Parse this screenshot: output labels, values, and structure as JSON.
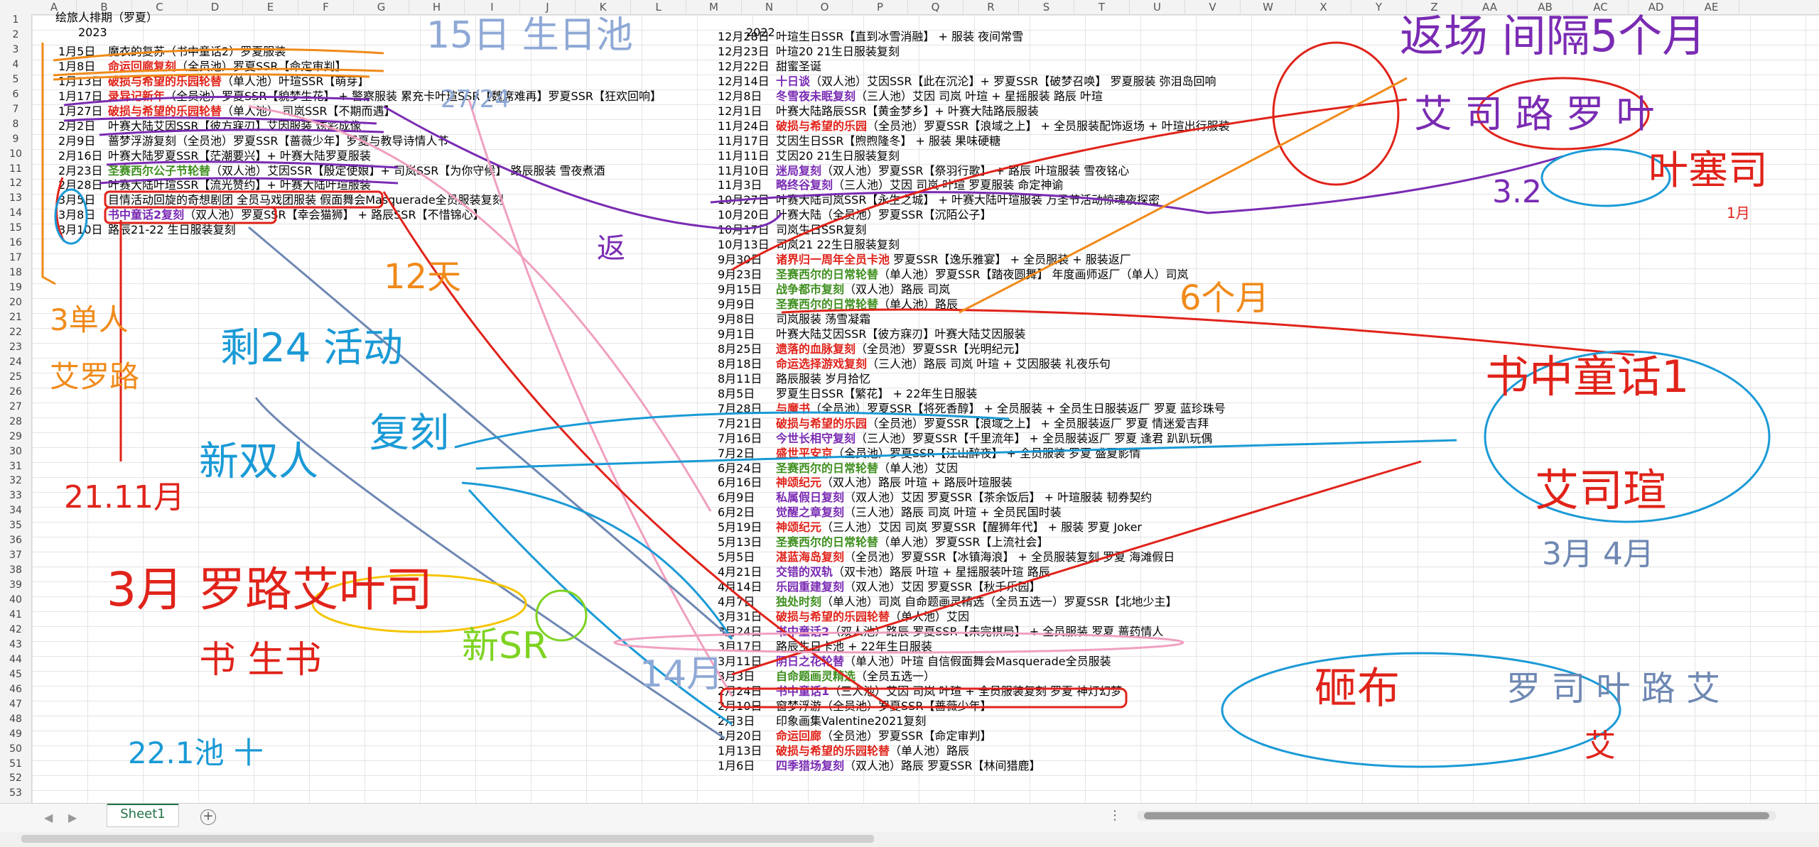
{
  "columns": [
    "A",
    "B",
    "C",
    "D",
    "E",
    "F",
    "G",
    "H",
    "I",
    "J",
    "K",
    "L",
    "M",
    "N",
    "O",
    "P",
    "Q",
    "R",
    "S",
    "T",
    "U",
    "V",
    "W",
    "X",
    "Y",
    "Z",
    "AA",
    "AB",
    "AC",
    "AD",
    "AE"
  ],
  "rows": [
    "1",
    "2",
    "3",
    "4",
    "5",
    "6",
    "7",
    "8",
    "9",
    "10",
    "11",
    "12",
    "13",
    "14",
    "15",
    "16",
    "17",
    "18",
    "19",
    "20",
    "21",
    "22",
    "23",
    "24",
    "25",
    "26",
    "27",
    "28",
    "29",
    "30",
    "31",
    "32",
    "33",
    "34",
    "35",
    "36",
    "37",
    "38",
    "39",
    "40",
    "41",
    "42",
    "43",
    "44",
    "45",
    "46",
    "47",
    "48",
    "49",
    "50",
    "51",
    "52",
    "53"
  ],
  "sheet": {
    "title": "绘旅人排期（罗夏）",
    "year_left": "2023",
    "year_right": "2022",
    "tab_name": "Sheet1"
  },
  "left_entries": [
    {
      "date": "1月5日",
      "text": "魔衣的复苏（书中童话2）罗夏服装"
    },
    {
      "date": "1月8日",
      "text": "命运回廊复刻（全员池）罗夏SSR【命定审判】"
    },
    {
      "date": "1月13日",
      "text": "破损与希望的乐园轮替（单人池）叶瑄SSR【萌芽】"
    },
    {
      "date": "1月17日",
      "text": "录异记新年（全员池）罗夏SSR【貌梦生花】 + 警察服装    累充卡叶瑄SSR【魏席难再】罗夏SSR【狂欢回响】"
    },
    {
      "date": "1月27日",
      "text": "破损与希望的乐园轮替（单人池） 司岚SSR【不期而遇】"
    },
    {
      "date": "2月2日",
      "text": "叶赛大陆艾因SSR【彼方寐刃】艾因服装 炫彩成像"
    },
    {
      "date": "2月9日",
      "text": "蔷梦浮游复刻（全员池）罗夏SSR【蔷薇少年】罗夏与教导诗情人节"
    },
    {
      "date": "2月16日",
      "text": "叶赛大陆罗夏SSR【茫潮要兴】+ 叶赛大陆罗夏服装"
    },
    {
      "date": "2月23日",
      "text": "圣赛西尔公子节轮替（双人池）艾因SSR【殷定使娘】+ 司岚SSR【为你守候】 路辰服装 雪夜煮酒"
    },
    {
      "date": "2月28日",
      "text": "叶赛大陆叶瑄SSR【流光赞约】+ 叶赛大陆叶瑄服装"
    },
    {
      "date": "3月5日",
      "text": "目情活动回旋的奇想剧团 全员马戏团服装    假面舞会Masquerade全员服装复刻"
    },
    {
      "date": "3月8日",
      "text": "书中童话2复刻（双人池）罗夏SSR【幸会猫狮】 + 路辰SSR【不惜锦心】"
    },
    {
      "date": "3月10日",
      "text": "路辰21-22 生日服装复刻"
    }
  ],
  "right_entries": [
    {
      "date": "12月28日",
      "text": "叶瑄生日SSR【直到冰雪消融】 + 服装 夜间常雪"
    },
    {
      "date": "12月23日",
      "text": "叶瑄20 21生日服装复刻"
    },
    {
      "date": "12月22日",
      "text": "甜蜜圣诞"
    },
    {
      "date": "12月14日",
      "text": "十日谈（双人池）艾因SSR【此在沉沦】+ 罗夏SSR【破梦召唤】 罗夏服装 弥泪岛回响"
    },
    {
      "date": "12月8日",
      "text": "冬雪夜未眠复刻（三人池）艾因 司岚 叶瑄 + 星摇服装 路辰 叶瑄"
    },
    {
      "date": "12月1日",
      "text": "叶赛大陆路辰SSR【黄金梦乡】+ 叶赛大陆路辰服装"
    },
    {
      "date": "11月24日",
      "text": "破损与希望的乐园（全员池）罗夏SSR【浪域之上】 + 全员服装配饰返场 + 叶瑄出行服装"
    },
    {
      "date": "11月17日",
      "text": "艾因生日SSR【煦煦隆冬】 + 服装 果味硬糖"
    },
    {
      "date": "11月11日",
      "text": "艾因20 21生日服装复刻"
    },
    {
      "date": "11月10日",
      "text": "迷局复刻（双人池）罗夏SSR【祭羽行歌】 + 路辰 叶瑄服装 雪夜铭心"
    },
    {
      "date": "11月3日",
      "text": "略终谷复刻（三人池）艾因 司岚 叶瑄 罗夏服装 命定神谕"
    },
    {
      "date": "10月27日",
      "text": "叶赛大陆司岚SSR【永生之城】 + 叶赛大陆叶瑄服装 万圣节活动惊魂夜探密"
    },
    {
      "date": "10月20日",
      "text": "叶赛大陆（全员池）罗夏SSR【沉陌公子】"
    },
    {
      "date": "10月17日",
      "text": "司岚生日SSR复刻"
    },
    {
      "date": "10月13日",
      "text": "司岚21 22生日服装复刻"
    },
    {
      "date": "9月30日",
      "text": "诸界归一周年全员卡池 罗夏SSR【逸乐雅宴】 + 全员服装 + 服装返厂"
    },
    {
      "date": "9月23日",
      "text": "圣赛西尔的日常轮替（单人池）罗夏SSR【踏夜圆舞】 年度画师返厂（单人）司岚"
    },
    {
      "date": "9月15日",
      "text": "战争都市复刻（双人池）路辰 司岚"
    },
    {
      "date": "9月9日",
      "text": "圣赛西尔的日常轮替（单人池）路辰"
    },
    {
      "date": "9月8日",
      "text": "司岚服装 荡雪凝霜"
    },
    {
      "date": "9月1日",
      "text": "叶赛大陆艾因SSR【彼方寐刃】叶赛大陆艾因服装"
    },
    {
      "date": "8月25日",
      "text": "遗落的血脉复刻（全员池）罗夏SSR【光明纪元】"
    },
    {
      "date": "8月18日",
      "text": "命运选择游戏复刻（三人池）路辰 司岚 叶瑄 + 艾因服装 礼夜乐句"
    },
    {
      "date": "8月11日",
      "text": "路辰服装 岁月拾忆"
    },
    {
      "date": "8月5日",
      "text": "罗夏生日SSR【繁花】 + 22年生日服装"
    },
    {
      "date": "7月28日",
      "text": "与魔书（全员池）罗夏SSR【将死香醇】 + 全员服装 + 全员生日服装返厂 罗夏 蓝珍珠号"
    },
    {
      "date": "7月21日",
      "text": "破损与希望的乐园（全员池）罗夏SSR【浪域之上】 + 全员服装返厂 罗夏 情迷爱吉拜"
    },
    {
      "date": "7月16日",
      "text": "今世长相守复刻（三人池）罗夏SSR【千里流年】 + 全员服装返厂 罗夏 逢君 趴趴玩偶"
    },
    {
      "date": "7月2日",
      "text": "盛世平安京（全员池）罗夏SSR【江山醉夜】 + 全员服装 罗夏 盛夏影情"
    },
    {
      "date": "6月24日",
      "text": "圣赛西尔的日常轮替（单人池）艾因"
    },
    {
      "date": "6月16日",
      "text": "神颂纪元（双人池）路辰 叶瑄 + 路辰叶瑄服装"
    },
    {
      "date": "6月9日",
      "text": "私属假日复刻（双人池）艾因 罗夏SSR【茶余饭后】 + 叶瑄服装 韧券契约"
    },
    {
      "date": "6月2日",
      "text": "觉醒之章复刻（三人池）路辰 司岚 叶瑄 + 全员民国时装"
    },
    {
      "date": "5月19日",
      "text": "神颂纪元（三人池）艾因 司岚 罗夏SSR【醒狮年代】 + 服装 罗夏 Joker"
    },
    {
      "date": "5月13日",
      "text": "圣赛西尔的日常轮替（单人池）罗夏SSR【上流社会】"
    },
    {
      "date": "5月5日",
      "text": "湛蓝海岛复刻（全员池）罗夏SSR【冰镇海浪】 + 全员服装复刻 罗夏 海滩假日"
    },
    {
      "date": "4月21日",
      "text": "交错的双轨（双卡池）路辰 叶瑄 + 星摇服装叶瑄 路辰"
    },
    {
      "date": "4月14日",
      "text": "乐园重建复刻（双人池）艾因 罗夏SSR【秋千乐园】"
    },
    {
      "date": "4月7日",
      "text": "独处时刻（单人池）司岚 自命题画灵精选（全员五选一）罗夏SSR【北地少主】"
    },
    {
      "date": "3月31日",
      "text": "破损与希望的乐园轮替（单人池）艾因"
    },
    {
      "date": "3月24日",
      "text": "书中童话2（双人池）路辰 罗夏SSR【未完棋局】 + 全员服装 罗夏 蔷药情人"
    },
    {
      "date": "3月17日",
      "text": "路辰生日卡池 + 22年生日服装"
    },
    {
      "date": "3月11日",
      "text": "阴日之花轮替（单人池）叶瑄 自信假面舞会Masquerade全员服装"
    },
    {
      "date": "3月3日",
      "text": "自命题画灵精选（全员五选一）"
    },
    {
      "date": "2月24日",
      "text": "书中童话1（三人池）艾因 司岚 叶瑄 + 全员服装复刻 罗夏 神灯幻梦"
    },
    {
      "date": "2月10日",
      "text": "窗梦浮游（全员池）罗夏SSR【蔷薇少年】"
    },
    {
      "date": "2月3日",
      "text": "印象画集Valentine2021复刻"
    },
    {
      "date": "1月20日",
      "text": "命运回廊（全员池）罗夏SSR【命定审判】"
    },
    {
      "date": "1月13日",
      "text": "破损与希望的乐园轮替（单人池）路辰"
    },
    {
      "date": "1月6日",
      "text": "四季猎场复刻（双人池）路辰 罗夏SSR【林间猎鹿】"
    }
  ],
  "annotations": [
    "15日 生日池",
    "27/24",
    "3单人",
    "艾罗路",
    "12天",
    "剩24 活动",
    "新双人",
    "复刻",
    "21.11月",
    "3月 罗路艾叶司",
    "书 生书",
    "22.1池 十",
    "新SR",
    "14月",
    "返场 间隔5个月",
    "艾 司 路 罗 叶",
    "3.2",
    "叶塞司",
    "书中童话1",
    "艾司瑄",
    "3月 4月",
    "砸布",
    "罗 司 叶 路 艾",
    "艾",
    "1月",
    "6个月",
    "返"
  ],
  "colors": {
    "red": "#e0231a",
    "green": "#3f8f1f",
    "purple": "#7a2bb3",
    "blue": "#3a78c9",
    "accent": "#217346"
  }
}
